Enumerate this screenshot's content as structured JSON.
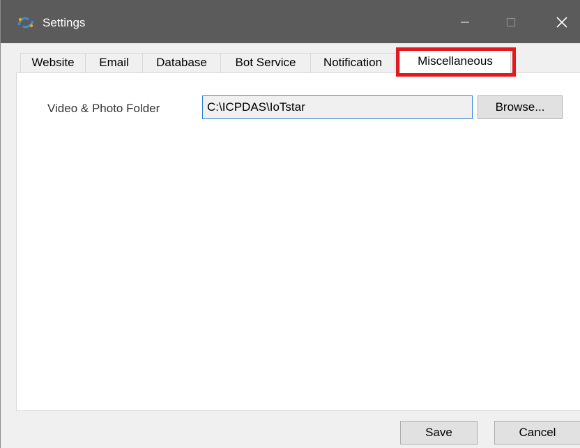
{
  "window": {
    "title": "Settings",
    "app_icon": "iotstar-logo-icon",
    "controls": {
      "minimize_icon": "minimize-icon",
      "maximize_icon": "maximize-icon",
      "close_icon": "close-icon"
    }
  },
  "tabs": [
    {
      "label": "Website"
    },
    {
      "label": "Email"
    },
    {
      "label": "Database"
    },
    {
      "label": "Bot Service"
    },
    {
      "label": "Notification"
    },
    {
      "label": "Miscellaneous",
      "selected": true
    }
  ],
  "misc": {
    "folder_label": "Video & Photo Folder",
    "folder_value": "C:\\ICPDAS\\IoTstar",
    "browse_label": "Browse..."
  },
  "footer": {
    "save_label": "Save",
    "cancel_label": "Cancel"
  },
  "colors": {
    "titlebar": "#5b5b5b",
    "highlight": "#e2191f",
    "input_border": "#2b7fd4"
  }
}
